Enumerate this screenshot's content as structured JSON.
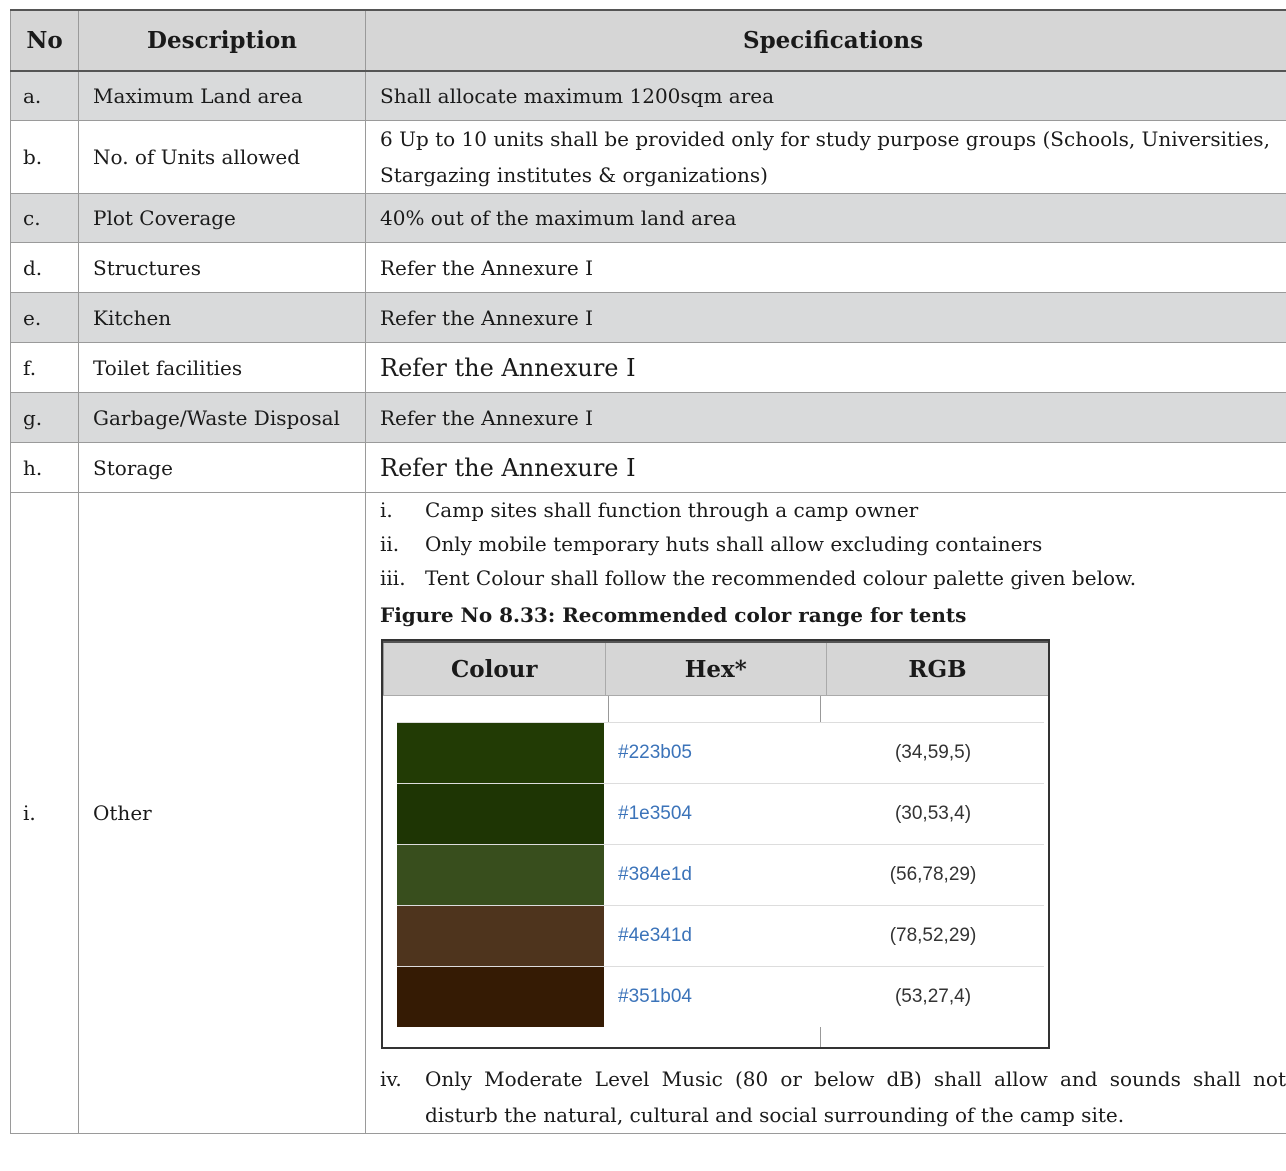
{
  "headers": {
    "no": "No",
    "description": "Description",
    "specifications": "Specifications"
  },
  "rows": [
    {
      "no": "a.",
      "description": "Maximum Land area",
      "spec": "Shall allocate maximum 1200sqm area"
    },
    {
      "no": "b.",
      "description": "No. of Units allowed",
      "spec": "6 Up to 10 units shall be provided only for study purpose groups (Schools, Universities, Stargazing institutes & organizations)"
    },
    {
      "no": "c.",
      "description": "Plot Coverage",
      "spec": "40% out of the maximum land area"
    },
    {
      "no": "d.",
      "description": "Structures",
      "spec": "Refer the Annexure I"
    },
    {
      "no": "e.",
      "description": "Kitchen",
      "spec": "Refer the Annexure I"
    },
    {
      "no": "f.",
      "description": "Toilet facilities",
      "spec": "Refer the Annexure I"
    },
    {
      "no": "g.",
      "description": "Garbage/Waste Disposal",
      "spec": "Refer the Annexure I"
    },
    {
      "no": "h.",
      "description": "Storage",
      "spec": "Refer the Annexure I"
    }
  ],
  "other": {
    "no": "i.",
    "description": "Other",
    "items": [
      {
        "num": "i.",
        "text": "Camp sites shall function through a camp owner"
      },
      {
        "num": "ii.",
        "text": "Only mobile temporary huts shall allow excluding containers"
      },
      {
        "num": "iii.",
        "text": "Tent Colour shall follow the recommended colour palette given below."
      }
    ],
    "figure_caption": "Figure No 8.33: Recommended color range for tents",
    "color_headers": {
      "colour": "Colour",
      "hex": "Hex*",
      "rgb": "RGB"
    },
    "colors": [
      {
        "hex": "#223b05",
        "rgb": "(34,59,5)"
      },
      {
        "hex": "#1e3504",
        "rgb": "(30,53,4)"
      },
      {
        "hex": "#384e1d",
        "rgb": "(56,78,29)"
      },
      {
        "hex": "#4e341d",
        "rgb": "(78,52,29)"
      },
      {
        "hex": "#351b04",
        "rgb": "(53,27,4)"
      }
    ],
    "item_iv": {
      "num": "iv.",
      "text": "Only Moderate Level Music (80 or below dB) shall  allow and sounds shall not disturb the natural, cultural and social surrounding of the camp site."
    }
  }
}
